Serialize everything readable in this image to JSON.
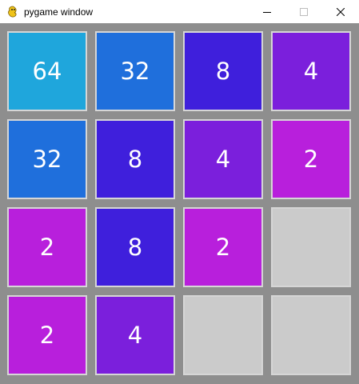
{
  "window": {
    "title": "pygame window",
    "app_icon": "pygame-snake-icon",
    "controls": [
      "minimize-icon",
      "maximize-icon",
      "close-icon"
    ]
  },
  "colors": {
    "empty": "#cbcbcb",
    "board_bg": "#8e8e8e",
    "tile_border": "#d6d6d6",
    "2": "#b81fdc",
    "4": "#7b1fdc",
    "8": "#3f1fdc",
    "32": "#1f6fdc",
    "64": "#1fa6dc"
  },
  "grid": [
    [
      "64",
      "32",
      "8",
      "4"
    ],
    [
      "32",
      "8",
      "4",
      "2"
    ],
    [
      "2",
      "8",
      "2",
      ""
    ],
    [
      "2",
      "4",
      "",
      ""
    ]
  ]
}
